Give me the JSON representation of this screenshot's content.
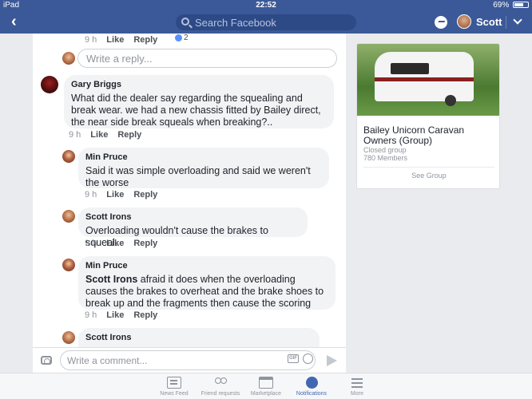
{
  "status_bar": {
    "device": "iPad",
    "time": "22:52",
    "battery": "69%",
    "battery_level": 0.69
  },
  "nav": {
    "search_placeholder": "Search Facebook",
    "user_name": "Scott"
  },
  "top_meta": {
    "time": "9 h",
    "like": "Like",
    "reply": "Reply",
    "reaction_count": "2"
  },
  "reply_box": {
    "placeholder": "Write a reply..."
  },
  "comments": [
    {
      "author": "Gary Briggs",
      "text": "What did the dealer say regarding the squealing and break wear. we had a new chassis fitted by Bailey direct, the near side break squeals when breaking?..",
      "time": "9 h",
      "like": "Like",
      "reply": "Reply"
    },
    {
      "author": "Min Pruce",
      "text": "Said it was simple overloading and said we weren't the worse",
      "time": "9 h",
      "like": "Like",
      "reply": "Reply"
    },
    {
      "author": "Scott Irons",
      "text": "Overloading wouldn't cause the brakes to squeal.",
      "time": "9 h",
      "like": "Like",
      "reply": "Reply"
    },
    {
      "author": "Min Pruce",
      "tag": "Scott Irons",
      "text": " afraid it does when the overloading causes the brakes to overheat and the brake shoes to break up and the fragments then cause the scoring",
      "time": "9 h",
      "like": "Like",
      "reply": "Reply"
    },
    {
      "author": "Scott Irons"
    }
  ],
  "composer": {
    "placeholder": "Write a comment...",
    "gif_label": "GIF"
  },
  "group_card": {
    "title": "Bailey Unicorn  Caravan Owners (Group)",
    "privacy": "Closed group",
    "members": "780 Members",
    "action": "See Group"
  },
  "tabs": [
    {
      "label": "News Feed",
      "icon": "news-feed-icon",
      "active": false
    },
    {
      "label": "Friend requests",
      "icon": "friends-icon",
      "active": false
    },
    {
      "label": "Marketplace",
      "icon": "marketplace-icon",
      "active": false
    },
    {
      "label": "Notifications",
      "icon": "globe-icon",
      "active": true
    },
    {
      "label": "More",
      "icon": "menu-icon",
      "active": false
    }
  ],
  "colors": {
    "brand": "#3b5998",
    "accent": "#4267b2",
    "bubble": "#f2f3f5"
  }
}
